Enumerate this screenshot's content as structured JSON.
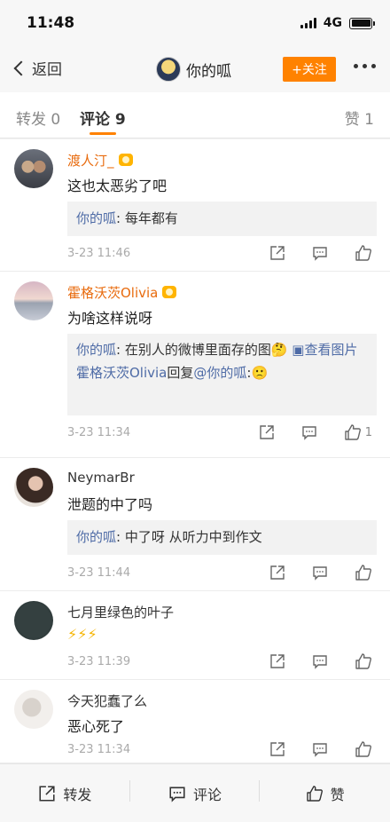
{
  "status_bar": {
    "time": "11:48",
    "network": "4G"
  },
  "nav": {
    "back_label": "返回",
    "title": "你的呱",
    "follow_label": "+关注"
  },
  "tabs": {
    "repost": "转发 0",
    "comment": "评论 9",
    "like": "赞 1"
  },
  "comments": [
    {
      "author": "渡人汀_",
      "text": "这也太恶劣了吧",
      "reply": {
        "name": "你的呱",
        "body": ": 每年都有"
      },
      "time": "3-23 11:46"
    },
    {
      "author": "霍格沃茨Olivia",
      "text": "为啥这样说呀",
      "reply": {
        "name": "你的呱",
        "body": ": 在别人的微博里面存的图🤔 ",
        "view_image": "查看图片"
      },
      "reply2": {
        "name": "霍格沃茨Olivia",
        "mid": "回复",
        "mention": "@你的呱",
        "tail": ":🙁"
      },
      "time": "3-23 11:34",
      "likes": "1"
    },
    {
      "author": "NeymarBr",
      "text": "泄题的中了吗",
      "reply": {
        "name": "你的呱",
        "body": ": 中了呀 从听力中到作文"
      },
      "time": "3-23 11:44"
    },
    {
      "author": "七月里绿色的叶子",
      "text": "⚡⚡⚡",
      "time": "3-23 11:39"
    },
    {
      "author": "今天犯蠢了么",
      "text": "恶心死了",
      "time": "3-23 11:34"
    }
  ],
  "bottom_bar": {
    "repost": "转发",
    "comment": "评论",
    "like": "赞"
  },
  "colors": {
    "accent": "#ff8200",
    "link": "#4e6ba6",
    "vip_name": "#e86b0e"
  }
}
